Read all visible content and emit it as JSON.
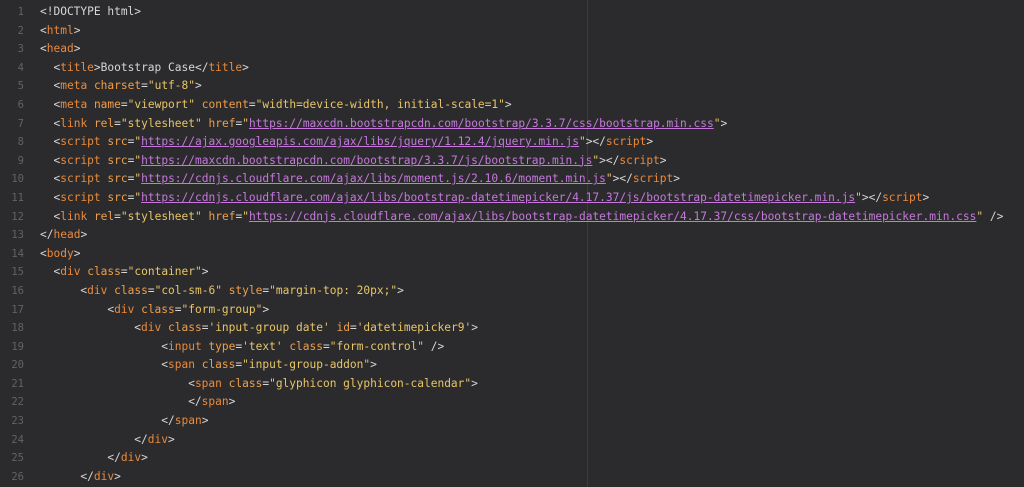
{
  "editor": {
    "lines": [
      {
        "num": "1",
        "indent": "",
        "tokens": [
          {
            "t": "punc",
            "v": "<!DOCTYPE html>"
          }
        ]
      },
      {
        "num": "2",
        "indent": "",
        "tokens": [
          {
            "t": "punc",
            "v": "<"
          },
          {
            "t": "tag",
            "v": "html"
          },
          {
            "t": "punc",
            "v": ">"
          }
        ]
      },
      {
        "num": "3",
        "indent": "",
        "tokens": [
          {
            "t": "punc",
            "v": "<"
          },
          {
            "t": "tag",
            "v": "head"
          },
          {
            "t": "punc",
            "v": ">"
          }
        ]
      },
      {
        "num": "4",
        "indent": "  ",
        "tokens": [
          {
            "t": "punc",
            "v": "<"
          },
          {
            "t": "tag",
            "v": "title"
          },
          {
            "t": "punc",
            "v": ">Bootstrap Case</"
          },
          {
            "t": "tag",
            "v": "title"
          },
          {
            "t": "punc",
            "v": ">"
          }
        ]
      },
      {
        "num": "5",
        "indent": "  ",
        "tokens": [
          {
            "t": "punc",
            "v": "<"
          },
          {
            "t": "tag",
            "v": "meta"
          },
          {
            "t": "punc",
            "v": " "
          },
          {
            "t": "attr",
            "v": "charset"
          },
          {
            "t": "punc",
            "v": "="
          },
          {
            "t": "str",
            "v": "\"utf-8\""
          },
          {
            "t": "punc",
            "v": ">"
          }
        ]
      },
      {
        "num": "6",
        "indent": "  ",
        "tokens": [
          {
            "t": "punc",
            "v": "<"
          },
          {
            "t": "tag",
            "v": "meta"
          },
          {
            "t": "punc",
            "v": " "
          },
          {
            "t": "attr",
            "v": "name"
          },
          {
            "t": "punc",
            "v": "="
          },
          {
            "t": "str",
            "v": "\"viewport\""
          },
          {
            "t": "punc",
            "v": " "
          },
          {
            "t": "attr",
            "v": "content"
          },
          {
            "t": "punc",
            "v": "="
          },
          {
            "t": "str",
            "v": "\"width=device-width, initial-scale=1\""
          },
          {
            "t": "punc",
            "v": ">"
          }
        ]
      },
      {
        "num": "7",
        "indent": "  ",
        "tokens": [
          {
            "t": "punc",
            "v": "<"
          },
          {
            "t": "tag",
            "v": "link"
          },
          {
            "t": "punc",
            "v": " "
          },
          {
            "t": "attr",
            "v": "rel"
          },
          {
            "t": "punc",
            "v": "="
          },
          {
            "t": "str",
            "v": "\"stylesheet\""
          },
          {
            "t": "punc",
            "v": " "
          },
          {
            "t": "attr",
            "v": "href"
          },
          {
            "t": "punc",
            "v": "="
          },
          {
            "t": "str",
            "v": "\""
          },
          {
            "t": "url",
            "v": "https://maxcdn.bootstrapcdn.com/bootstrap/3.3.7/css/bootstrap.min.css"
          },
          {
            "t": "str",
            "v": "\""
          },
          {
            "t": "punc",
            "v": ">"
          }
        ]
      },
      {
        "num": "8",
        "indent": "  ",
        "tokens": [
          {
            "t": "punc",
            "v": "<"
          },
          {
            "t": "tag",
            "v": "script"
          },
          {
            "t": "punc",
            "v": " "
          },
          {
            "t": "attr",
            "v": "src"
          },
          {
            "t": "punc",
            "v": "="
          },
          {
            "t": "str",
            "v": "\""
          },
          {
            "t": "url",
            "v": "https://ajax.googleapis.com/ajax/libs/jquery/1.12.4/jquery.min.js"
          },
          {
            "t": "str",
            "v": "\""
          },
          {
            "t": "punc",
            "v": "></"
          },
          {
            "t": "tag",
            "v": "script"
          },
          {
            "t": "punc",
            "v": ">"
          }
        ]
      },
      {
        "num": "9",
        "indent": "  ",
        "tokens": [
          {
            "t": "punc",
            "v": "<"
          },
          {
            "t": "tag",
            "v": "script"
          },
          {
            "t": "punc",
            "v": " "
          },
          {
            "t": "attr",
            "v": "src"
          },
          {
            "t": "punc",
            "v": "="
          },
          {
            "t": "str",
            "v": "\""
          },
          {
            "t": "url",
            "v": "https://maxcdn.bootstrapcdn.com/bootstrap/3.3.7/js/bootstrap.min.js"
          },
          {
            "t": "str",
            "v": "\""
          },
          {
            "t": "punc",
            "v": "></"
          },
          {
            "t": "tag",
            "v": "script"
          },
          {
            "t": "punc",
            "v": ">"
          }
        ]
      },
      {
        "num": "10",
        "indent": "  ",
        "tokens": [
          {
            "t": "punc",
            "v": "<"
          },
          {
            "t": "tag",
            "v": "script"
          },
          {
            "t": "punc",
            "v": " "
          },
          {
            "t": "attr",
            "v": "src"
          },
          {
            "t": "punc",
            "v": "="
          },
          {
            "t": "str",
            "v": "\""
          },
          {
            "t": "url",
            "v": "https://cdnjs.cloudflare.com/ajax/libs/moment.js/2.10.6/moment.min.js"
          },
          {
            "t": "str",
            "v": "\""
          },
          {
            "t": "punc",
            "v": "></"
          },
          {
            "t": "tag",
            "v": "script"
          },
          {
            "t": "punc",
            "v": ">"
          }
        ]
      },
      {
        "num": "11",
        "indent": "  ",
        "tokens": [
          {
            "t": "punc",
            "v": "<"
          },
          {
            "t": "tag",
            "v": "script"
          },
          {
            "t": "punc",
            "v": " "
          },
          {
            "t": "attr",
            "v": "src"
          },
          {
            "t": "punc",
            "v": "="
          },
          {
            "t": "str",
            "v": "\""
          },
          {
            "t": "url",
            "v": "https://cdnjs.cloudflare.com/ajax/libs/bootstrap-datetimepicker/4.17.37/js/bootstrap-datetimepicker.min.js"
          },
          {
            "t": "str",
            "v": "\""
          },
          {
            "t": "punc",
            "v": "></"
          },
          {
            "t": "tag",
            "v": "script"
          },
          {
            "t": "punc",
            "v": ">"
          }
        ]
      },
      {
        "num": "12",
        "indent": "  ",
        "tokens": [
          {
            "t": "punc",
            "v": "<"
          },
          {
            "t": "tag",
            "v": "link"
          },
          {
            "t": "punc",
            "v": " "
          },
          {
            "t": "attr",
            "v": "rel"
          },
          {
            "t": "punc",
            "v": "="
          },
          {
            "t": "str",
            "v": "\"stylesheet\""
          },
          {
            "t": "punc",
            "v": " "
          },
          {
            "t": "attr",
            "v": "href"
          },
          {
            "t": "punc",
            "v": "="
          },
          {
            "t": "str",
            "v": "\""
          },
          {
            "t": "url",
            "v": "https://cdnjs.cloudflare.com/ajax/libs/bootstrap-datetimepicker/4.17.37/css/bootstrap-datetimepicker.min.css"
          },
          {
            "t": "str",
            "v": "\""
          },
          {
            "t": "punc",
            "v": " />"
          }
        ]
      },
      {
        "num": "13",
        "indent": "",
        "tokens": [
          {
            "t": "punc",
            "v": "</"
          },
          {
            "t": "tag",
            "v": "head"
          },
          {
            "t": "punc",
            "v": ">"
          }
        ]
      },
      {
        "num": "14",
        "indent": "",
        "tokens": [
          {
            "t": "punc",
            "v": "<"
          },
          {
            "t": "tag",
            "v": "body"
          },
          {
            "t": "punc",
            "v": ">"
          }
        ]
      },
      {
        "num": "15",
        "indent": "  ",
        "tokens": [
          {
            "t": "punc",
            "v": "<"
          },
          {
            "t": "tag",
            "v": "div"
          },
          {
            "t": "punc",
            "v": " "
          },
          {
            "t": "attr",
            "v": "class"
          },
          {
            "t": "punc",
            "v": "="
          },
          {
            "t": "str",
            "v": "\"container\""
          },
          {
            "t": "punc",
            "v": ">"
          }
        ]
      },
      {
        "num": "16",
        "indent": "      ",
        "tokens": [
          {
            "t": "punc",
            "v": "<"
          },
          {
            "t": "tag",
            "v": "div"
          },
          {
            "t": "punc",
            "v": " "
          },
          {
            "t": "attr",
            "v": "class"
          },
          {
            "t": "punc",
            "v": "="
          },
          {
            "t": "str",
            "v": "\"col-sm-6\""
          },
          {
            "t": "punc",
            "v": " "
          },
          {
            "t": "attr",
            "v": "style"
          },
          {
            "t": "punc",
            "v": "="
          },
          {
            "t": "str",
            "v": "\"margin-top: 20px;\""
          },
          {
            "t": "punc",
            "v": ">"
          }
        ]
      },
      {
        "num": "17",
        "indent": "          ",
        "tokens": [
          {
            "t": "punc",
            "v": "<"
          },
          {
            "t": "tag",
            "v": "div"
          },
          {
            "t": "punc",
            "v": " "
          },
          {
            "t": "attr",
            "v": "class"
          },
          {
            "t": "punc",
            "v": "="
          },
          {
            "t": "str",
            "v": "\"form-group\""
          },
          {
            "t": "punc",
            "v": ">"
          }
        ]
      },
      {
        "num": "18",
        "indent": "              ",
        "tokens": [
          {
            "t": "punc",
            "v": "<"
          },
          {
            "t": "tag",
            "v": "div"
          },
          {
            "t": "punc",
            "v": " "
          },
          {
            "t": "attr",
            "v": "class"
          },
          {
            "t": "punc",
            "v": "="
          },
          {
            "t": "str",
            "v": "'input-group date'"
          },
          {
            "t": "punc",
            "v": " "
          },
          {
            "t": "attr",
            "v": "id"
          },
          {
            "t": "punc",
            "v": "="
          },
          {
            "t": "str",
            "v": "'datetimepicker9'"
          },
          {
            "t": "punc",
            "v": ">"
          }
        ]
      },
      {
        "num": "19",
        "indent": "                  ",
        "tokens": [
          {
            "t": "punc",
            "v": "<"
          },
          {
            "t": "tag",
            "v": "input"
          },
          {
            "t": "punc",
            "v": " "
          },
          {
            "t": "attr",
            "v": "type"
          },
          {
            "t": "punc",
            "v": "="
          },
          {
            "t": "str",
            "v": "'text'"
          },
          {
            "t": "punc",
            "v": " "
          },
          {
            "t": "attr",
            "v": "class"
          },
          {
            "t": "punc",
            "v": "="
          },
          {
            "t": "str",
            "v": "\"form-control\""
          },
          {
            "t": "punc",
            "v": " />"
          }
        ]
      },
      {
        "num": "20",
        "indent": "                  ",
        "tokens": [
          {
            "t": "punc",
            "v": "<"
          },
          {
            "t": "tag",
            "v": "span"
          },
          {
            "t": "punc",
            "v": " "
          },
          {
            "t": "attr",
            "v": "class"
          },
          {
            "t": "punc",
            "v": "="
          },
          {
            "t": "str",
            "v": "\"input-group-addon\""
          },
          {
            "t": "punc",
            "v": ">"
          }
        ]
      },
      {
        "num": "21",
        "indent": "                      ",
        "tokens": [
          {
            "t": "punc",
            "v": "<"
          },
          {
            "t": "tag",
            "v": "span"
          },
          {
            "t": "punc",
            "v": " "
          },
          {
            "t": "attr",
            "v": "class"
          },
          {
            "t": "punc",
            "v": "="
          },
          {
            "t": "str",
            "v": "\"glyphicon glyphicon-calendar\""
          },
          {
            "t": "punc",
            "v": ">"
          }
        ]
      },
      {
        "num": "22",
        "indent": "                      ",
        "tokens": [
          {
            "t": "punc",
            "v": "</"
          },
          {
            "t": "tag",
            "v": "span"
          },
          {
            "t": "punc",
            "v": ">"
          }
        ]
      },
      {
        "num": "23",
        "indent": "                  ",
        "tokens": [
          {
            "t": "punc",
            "v": "</"
          },
          {
            "t": "tag",
            "v": "span"
          },
          {
            "t": "punc",
            "v": ">"
          }
        ]
      },
      {
        "num": "24",
        "indent": "              ",
        "tokens": [
          {
            "t": "punc",
            "v": "</"
          },
          {
            "t": "tag",
            "v": "div"
          },
          {
            "t": "punc",
            "v": ">"
          }
        ]
      },
      {
        "num": "25",
        "indent": "          ",
        "tokens": [
          {
            "t": "punc",
            "v": "</"
          },
          {
            "t": "tag",
            "v": "div"
          },
          {
            "t": "punc",
            "v": ">"
          }
        ]
      },
      {
        "num": "26",
        "indent": "      ",
        "tokens": [
          {
            "t": "punc",
            "v": "</"
          },
          {
            "t": "tag",
            "v": "div"
          },
          {
            "t": "punc",
            "v": ">"
          }
        ]
      }
    ]
  },
  "colors": {
    "background": "#2b2b2d",
    "line_number": "#626266",
    "tag": "#ea8a3c",
    "attribute": "#ef9e4a",
    "string": "#e8c567",
    "url": "#c678dd",
    "text": "#d6d6d6"
  }
}
